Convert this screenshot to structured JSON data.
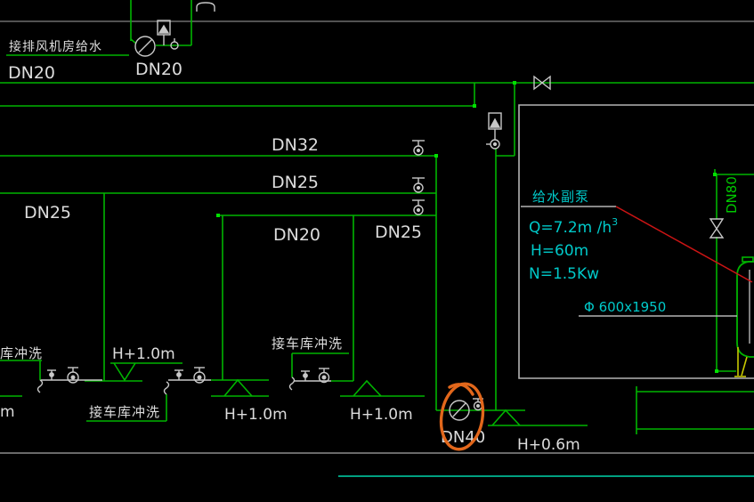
{
  "labels": {
    "exhaust_fan_note": "接排风机房给水",
    "dn20_left": "DN20",
    "dn20_meter": "DN20",
    "dn32": "DN32",
    "dn25_upper": "DN25",
    "dn25_left": "DN25",
    "dn20_branch": "DN20",
    "dn25_branch": "DN25",
    "garage_flush_partial": "库冲洗",
    "garage_flush_lower": "接车库冲洗",
    "garage_flush_upper": "接车库冲洗",
    "h10_left": "H+1.0m",
    "h10_mid": "H+1.0m",
    "h10_right": "H+1.0m",
    "m_partial": "m",
    "dn40": "DN40",
    "h06": "H+0.6m",
    "dn80": "DN80",
    "tank_dim": "Φ 600x1950"
  },
  "pump": {
    "title": "给水副泵",
    "flow_main": "Q=7.2m /h",
    "flow_sup": "3",
    "head": "H=60m",
    "power": "N=1.5Kw"
  },
  "colors": {
    "background": "#000000",
    "pipe_green": "#00b400",
    "bright_green": "#00e000",
    "white_line": "#c8c8c8",
    "gray_line": "#6e6e6e",
    "cyan_text": "#00c9c9",
    "red_leader": "#cc1414",
    "yellow_support": "#c8c800",
    "teal_baseline": "#00a080",
    "orange_highlight": "#e2671b"
  }
}
